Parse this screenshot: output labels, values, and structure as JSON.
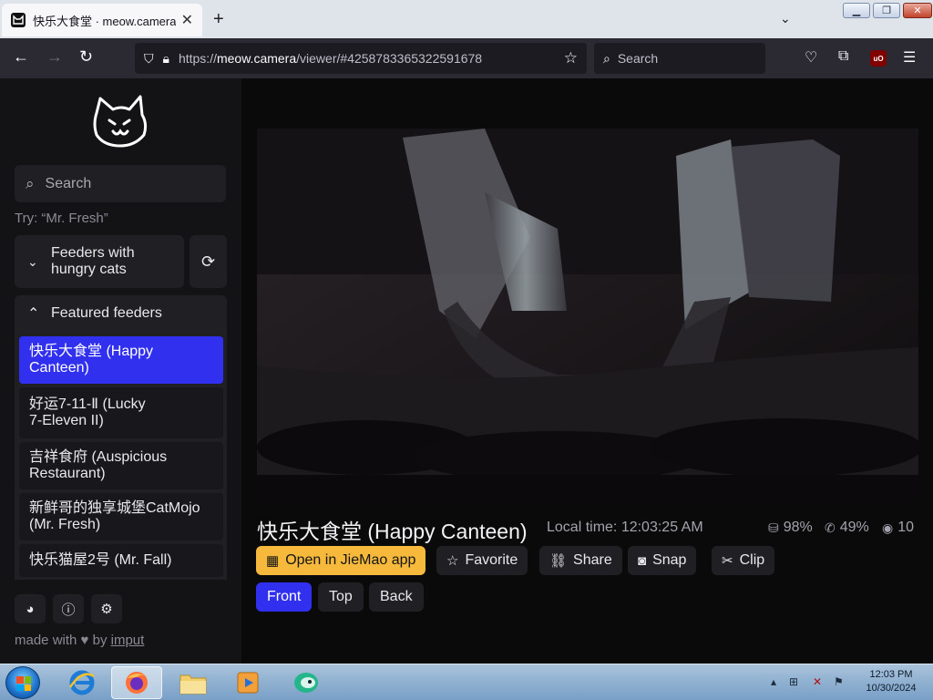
{
  "browser": {
    "tab_title": "快乐大食堂 · meow.camera",
    "url_scheme": "https://",
    "url_host": "meow.camera",
    "url_path": "/viewer/#4258783365322591678",
    "search_placeholder": "Search"
  },
  "sidebar": {
    "search_placeholder": "Search",
    "hint": "Try: “Mr. Fresh”",
    "hungry_section_line1": "Feeders with",
    "hungry_section_line2": "hungry cats",
    "featured_header": "Featured feeders",
    "featured_items": [
      {
        "line1": "快乐大食堂 (Happy",
        "line2": "Canteen)"
      },
      {
        "line1": "好运7-11-Ⅱ (Lucky",
        "line2": "7-Eleven II)"
      },
      {
        "line1": "吉祥食府 (Auspicious",
        "line2": "Restaurant)"
      },
      {
        "line1": "新鲜哥的独享城堡CatMojo",
        "line2": "(Mr. Fresh)"
      },
      {
        "line1": "快乐猫屋2号 (Mr. Fall)",
        "line2": ""
      }
    ],
    "made_with_prefix": "made with",
    "made_with_by": "by",
    "made_with_link": "imput"
  },
  "main": {
    "cam_title": "快乐大食堂 (Happy Canteen)",
    "local_time": "Local time: 12:03:25 AM",
    "food_level": "98%",
    "signal": "49%",
    "viewers": "10",
    "actions": {
      "open_app": "Open in JieMao app",
      "favorite": "Favorite",
      "share": "Share",
      "snap": "Snap",
      "clip": "Clip"
    },
    "views": {
      "front": "Front",
      "top": "Top",
      "back": "Back"
    }
  },
  "taskbar": {
    "time": "12:03 PM",
    "date": "10/30/2024"
  },
  "colors": {
    "accent": "#3030ee",
    "primary_button": "#f6b93b",
    "sidebar_bg": "#131316",
    "panel_bg": "#1f1f24"
  }
}
